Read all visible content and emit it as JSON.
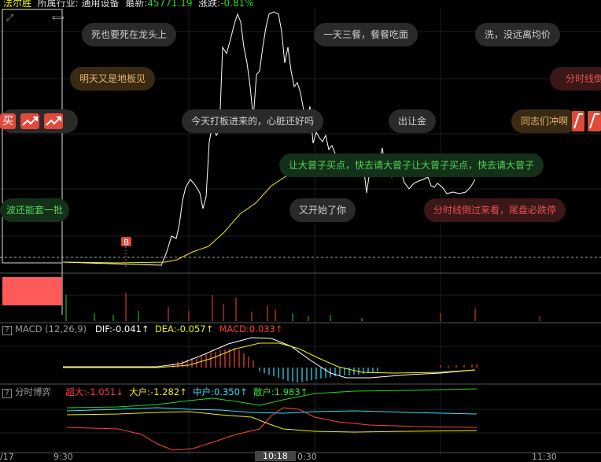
{
  "header": {
    "stock": "法尔胜",
    "industry_label": "所属行业:",
    "industry": "通用设备",
    "price_label": "最新:",
    "price": "45771.19",
    "change_label": "涨跌:",
    "change": "-0.81%"
  },
  "danmu": [
    {
      "text": "死也要死在龙头上",
      "style": "gray"
    },
    {
      "text": "一天三餐，餐餐吃面",
      "style": "gray"
    },
    {
      "text": "洗，没远离均价",
      "style": "gray"
    },
    {
      "text": "明天又是地板见",
      "style": "brown"
    },
    {
      "text": "分时线倒",
      "style": "red"
    },
    {
      "text": "今天打板进来的，心脏还好吗",
      "style": "gray"
    },
    {
      "text": "出让金",
      "style": "gray"
    },
    {
      "text": "同志们冲啊",
      "style": "brown"
    },
    {
      "text": "让大曾子买点，快去请大曾子让大曾子买点，快去请大曾子",
      "style": "green"
    },
    {
      "text": "波还能套一批",
      "style": "green"
    },
    {
      "text": "又开始了你",
      "style": "gray"
    },
    {
      "text": "分时线倒过来看，尾盘必跌停",
      "style": "red"
    }
  ],
  "badges": {
    "buy": "买",
    "b_marker": "B"
  },
  "macd": {
    "title": "MACD (12,26,9)",
    "dif": "DIF:-0.041↑",
    "dea": "DEA:-0.057↑",
    "macd": "MACD:0.033↑"
  },
  "fenshi": {
    "title": "分时博弈",
    "super": "超大:-1.051↓",
    "big": "大户:-1.282↑",
    "mid": "中户:0.350↑",
    "retail": "散户:1.983↑"
  },
  "time_axis": {
    "t0": "/17",
    "t1": "9:30",
    "t2": "10:18",
    "t3": "0:30",
    "t4": "11:30"
  },
  "colors": {
    "price": "#ffffff",
    "avg": "#f0f000",
    "up": "#ff4040",
    "down": "#22d822",
    "cyan": "#33e0ff"
  }
}
